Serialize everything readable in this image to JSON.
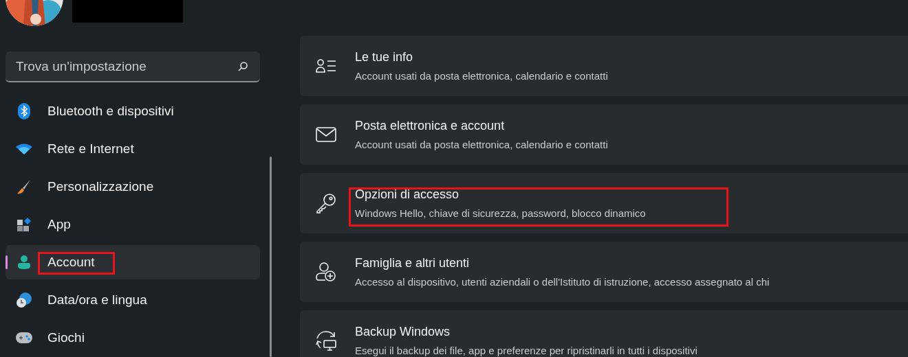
{
  "sidebar": {
    "search": {
      "placeholder": "Trova un'impostazione"
    },
    "items": [
      {
        "label": "Bluetooth e dispositivi",
        "selected": false,
        "highlighted": false
      },
      {
        "label": "Rete e Internet",
        "selected": false,
        "highlighted": false
      },
      {
        "label": "Personalizzazione",
        "selected": false,
        "highlighted": false
      },
      {
        "label": "App",
        "selected": false,
        "highlighted": false
      },
      {
        "label": "Account",
        "selected": true,
        "highlighted": true
      },
      {
        "label": "Data/ora e lingua",
        "selected": false,
        "highlighted": false
      },
      {
        "label": "Giochi",
        "selected": false,
        "highlighted": false
      }
    ]
  },
  "settings": [
    {
      "title": "Le tue info",
      "subtitle": "Account usati da posta elettronica, calendario e contatti",
      "highlighted": false
    },
    {
      "title": "Posta elettronica e account",
      "subtitle": "Account usati da posta elettronica, calendario e contatti",
      "highlighted": false
    },
    {
      "title": "Opzioni di accesso",
      "subtitle": "Windows Hello, chiave di sicurezza, password, blocco dinamico",
      "highlighted": true
    },
    {
      "title": "Famiglia e altri utenti",
      "subtitle": "Accesso al dispositivo, utenti aziendali o dell'Istituto di istruzione, accesso assegnato al chi",
      "highlighted": false
    },
    {
      "title": "Backup Windows",
      "subtitle": "Esegui il backup dei file, app e preferenze per ripristinarli in tutti i dispositivi",
      "highlighted": false
    }
  ]
}
